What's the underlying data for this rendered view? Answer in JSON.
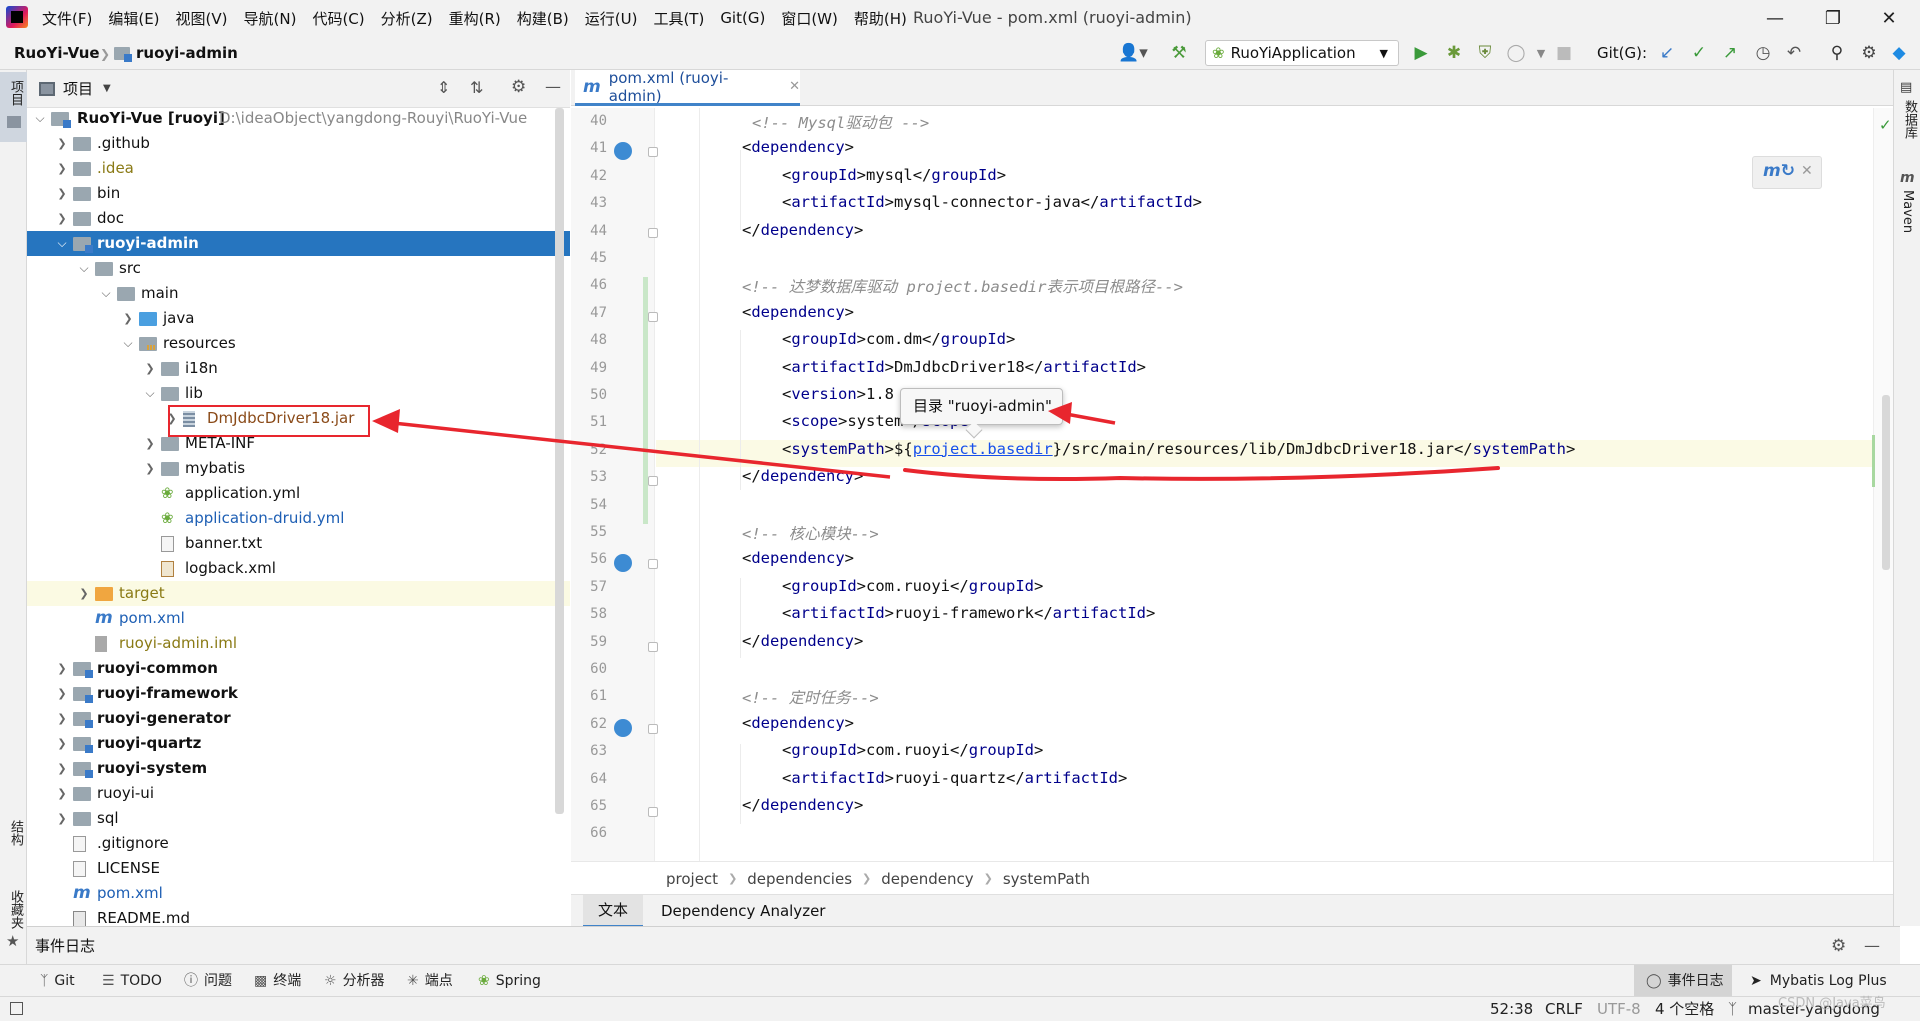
{
  "menubar": {
    "items": [
      "文件(F)",
      "编辑(E)",
      "视图(V)",
      "导航(N)",
      "代码(C)",
      "分析(Z)",
      "重构(R)",
      "构建(B)",
      "运行(U)",
      "工具(T)",
      "Git(G)",
      "窗口(W)",
      "帮助(H)"
    ],
    "title": "RuoYi-Vue - pom.xml (ruoyi-admin)"
  },
  "navbar": {
    "project": "RuoYi-Vue",
    "module": "ruoyi-admin",
    "run_config": "RuoYiApplication",
    "git_label": "Git(G):"
  },
  "left_stripe": {
    "project": "项目",
    "structure": "结构",
    "favorites": "收藏夹"
  },
  "right_stripe": {
    "database": "数据库",
    "maven": "Maven"
  },
  "project_panel": {
    "title": "项目",
    "root_name": "RuoYi-Vue [ruoyi]",
    "root_path": "D:\\ideaObject\\yangdong-Rouyi\\RuoYi-Vue",
    "items": [
      {
        "label": ".github"
      },
      {
        "label": ".idea"
      },
      {
        "label": "bin"
      },
      {
        "label": "doc"
      },
      {
        "label": "ruoyi-admin"
      },
      {
        "label": "src"
      },
      {
        "label": "main"
      },
      {
        "label": "java"
      },
      {
        "label": "resources"
      },
      {
        "label": "i18n"
      },
      {
        "label": "lib"
      },
      {
        "label": "DmJdbcDriver18.jar"
      },
      {
        "label": "META-INF"
      },
      {
        "label": "mybatis"
      },
      {
        "label": "application.yml"
      },
      {
        "label": "application-druid.yml"
      },
      {
        "label": "banner.txt"
      },
      {
        "label": "logback.xml"
      },
      {
        "label": "target"
      },
      {
        "label": "pom.xml"
      },
      {
        "label": "ruoyi-admin.iml"
      },
      {
        "label": "ruoyi-common"
      },
      {
        "label": "ruoyi-framework"
      },
      {
        "label": "ruoyi-generator"
      },
      {
        "label": "ruoyi-quartz"
      },
      {
        "label": "ruoyi-system"
      },
      {
        "label": "ruoyi-ui"
      },
      {
        "label": "sql"
      },
      {
        "label": ".gitignore"
      },
      {
        "label": "LICENSE"
      },
      {
        "label": "pom.xml"
      },
      {
        "label": "README.md"
      }
    ]
  },
  "editor": {
    "tab": "pom.xml (ruoyi-admin)",
    "line_numbers": [
      "40",
      "41",
      "42",
      "43",
      "44",
      "45",
      "46",
      "47",
      "48",
      "49",
      "50",
      "51",
      "52",
      "53",
      "54",
      "55",
      "56",
      "57",
      "58",
      "59",
      "60",
      "61",
      "62",
      "63",
      "64",
      "65",
      "66"
    ],
    "lines": {
      "l40": "<!-- Mysql驱动包 -->",
      "l46": "<!-- 达梦数据库驱动 project.basedir表示项目根路径-->",
      "l55": "<!-- 核心模块-->",
      "l61": "<!-- 定时任务-->",
      "dependency": "dependency",
      "groupId": "groupId",
      "artifactId": "artifactId",
      "version": "version",
      "scope": "scope",
      "systemPath": "systemPath",
      "mysql": "mysql",
      "mysql_connector": "mysql-connector-java",
      "com_dm": "com.dm",
      "dmjdbc": "DmJdbcDriver18",
      "version_val": "1.8",
      "system": "system",
      "path_prefix": "${",
      "basedir": "project.basedir",
      "path_rest": "}/src/main/resources/lib/DmJdbcDriver18.jar",
      "com_ruoyi": "com.ruoyi",
      "ruoyi_framework": "ruoyi-framework",
      "ruoyi_quartz": "ruoyi-quartz"
    },
    "tooltip": "目录 \"ruoyi-admin\"",
    "breadcrumb": [
      "project",
      "dependencies",
      "dependency",
      "systemPath"
    ],
    "bottom_tabs": [
      "文本",
      "Dependency Analyzer"
    ]
  },
  "event_log": {
    "title": "事件日志"
  },
  "tool_windows": [
    "Git",
    "TODO",
    "问题",
    "终端",
    "分析器",
    "端点",
    "Spring"
  ],
  "tool_windows_right": [
    "事件日志",
    "Mybatis Log Plus"
  ],
  "status": {
    "position": "52:38",
    "line_sep": "CRLF",
    "encoding": "UTF-8",
    "indent": "4 个空格",
    "branch": "master-yangdong",
    "watermark": "CSDN @Java菜鸟"
  },
  "colors": {
    "selection": "#2675bf",
    "annotation": "#e8262e",
    "tag": "#00008b",
    "accent": "#4083c9"
  }
}
